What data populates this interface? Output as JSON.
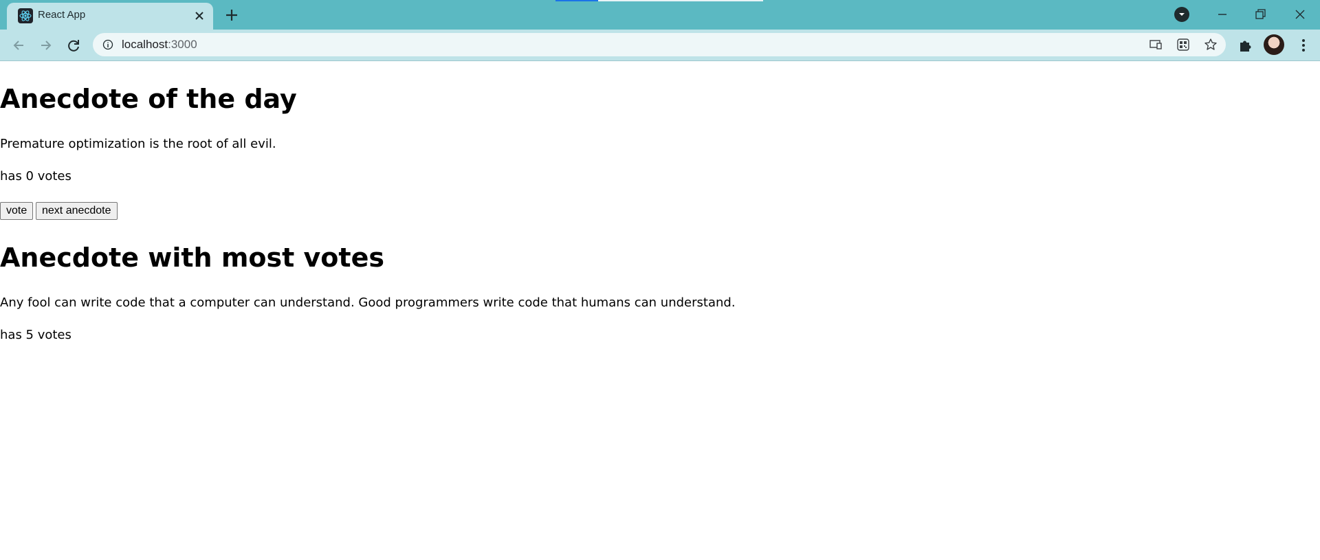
{
  "browser": {
    "tab": {
      "title": "React App"
    },
    "omnibox": {
      "host": "localhost",
      "port": ":3000"
    },
    "theme_color": "#5bb9c2"
  },
  "page": {
    "heading_day": "Anecdote of the day",
    "anecdote_day": "Premature optimization is the root of all evil.",
    "votes_day": "has 0 votes",
    "vote_button": "vote",
    "next_button": "next anecdote",
    "heading_most": "Anecdote with most votes",
    "anecdote_most": "Any fool can write code that a computer can understand. Good programmers write code that humans can understand.",
    "votes_most": "has 5 votes"
  }
}
